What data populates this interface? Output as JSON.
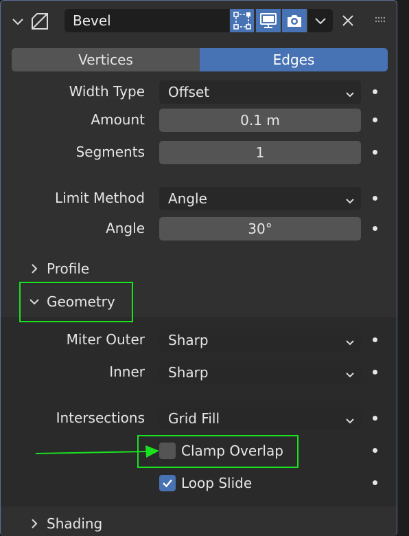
{
  "header": {
    "modifier_name": "Bevel",
    "icons": {
      "collapse": "chevron-down-icon",
      "modifier": "bevel-modifier-icon",
      "edit_mode": "edit-mode-icon",
      "viewport": "monitor-icon",
      "render": "camera-icon",
      "menu": "chevron-down-icon",
      "delete": "close-icon",
      "drag": "drag-handle-icon"
    }
  },
  "tabs": [
    {
      "label": "Vertices",
      "active": false
    },
    {
      "label": "Edges",
      "active": true
    }
  ],
  "properties": {
    "width_type": {
      "label": "Width Type",
      "value": "Offset"
    },
    "amount": {
      "label": "Amount",
      "value": "0.1 m"
    },
    "segments": {
      "label": "Segments",
      "value": "1"
    },
    "limit_method": {
      "label": "Limit Method",
      "value": "Angle"
    },
    "angle": {
      "label": "Angle",
      "value": "30°"
    }
  },
  "subpanels": {
    "profile": {
      "label": "Profile",
      "expanded": false
    },
    "geometry": {
      "label": "Geometry",
      "expanded": true
    },
    "shading": {
      "label": "Shading",
      "expanded": false
    }
  },
  "geometry": {
    "miter_outer": {
      "label": "Miter Outer",
      "value": "Sharp"
    },
    "inner": {
      "label": "Inner",
      "value": "Sharp"
    },
    "intersections": {
      "label": "Intersections",
      "value": "Grid Fill"
    },
    "clamp_overlap": {
      "label": "Clamp Overlap",
      "checked": false
    },
    "loop_slide": {
      "label": "Loop Slide",
      "checked": true
    }
  },
  "colors": {
    "accent": "#4772b3",
    "highlight": "#19e21f",
    "panel_bg": "#303030",
    "field_bg": "#282828",
    "number_bg": "#545454"
  }
}
